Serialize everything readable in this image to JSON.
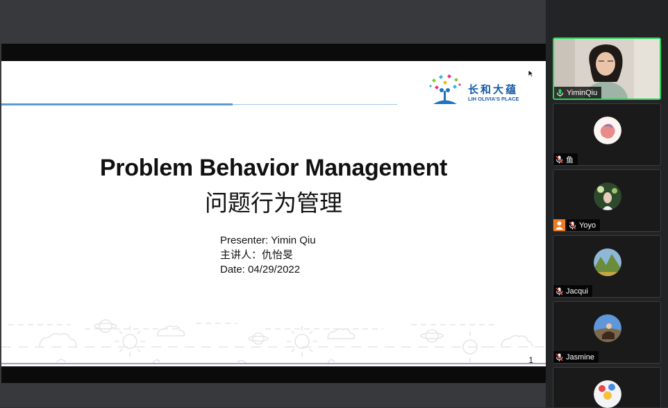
{
  "slide": {
    "title_en": "Problem Behavior Management",
    "title_cn": "问题行为管理",
    "presenter_line": "Presenter: Yimin Qiu",
    "presenter_cn_line": "主讲人：仇怡旻",
    "date_line": "Date: 04/29/2022",
    "page_number": "1",
    "logo": {
      "cn_text": "长和大蕴",
      "en_text": "LIH OLIVIA'S PLACE",
      "brand_color": "#1559a8"
    }
  },
  "participants": [
    {
      "name": "YiminQiu",
      "muted": false,
      "speaking": true,
      "video": true
    },
    {
      "name": "鱼",
      "muted": true,
      "video": false
    },
    {
      "name": "Yoyo",
      "muted": true,
      "video": false,
      "host_icon": true
    },
    {
      "name": "Jacqui",
      "muted": true,
      "video": false
    },
    {
      "name": "Jasmine",
      "muted": true,
      "video": false
    },
    {
      "name": "",
      "muted": true,
      "video": false
    }
  ],
  "colors": {
    "speaking_border": "#23d959",
    "mute_icon": "#e03c3c",
    "accent_rule": "#5b9bd5"
  }
}
